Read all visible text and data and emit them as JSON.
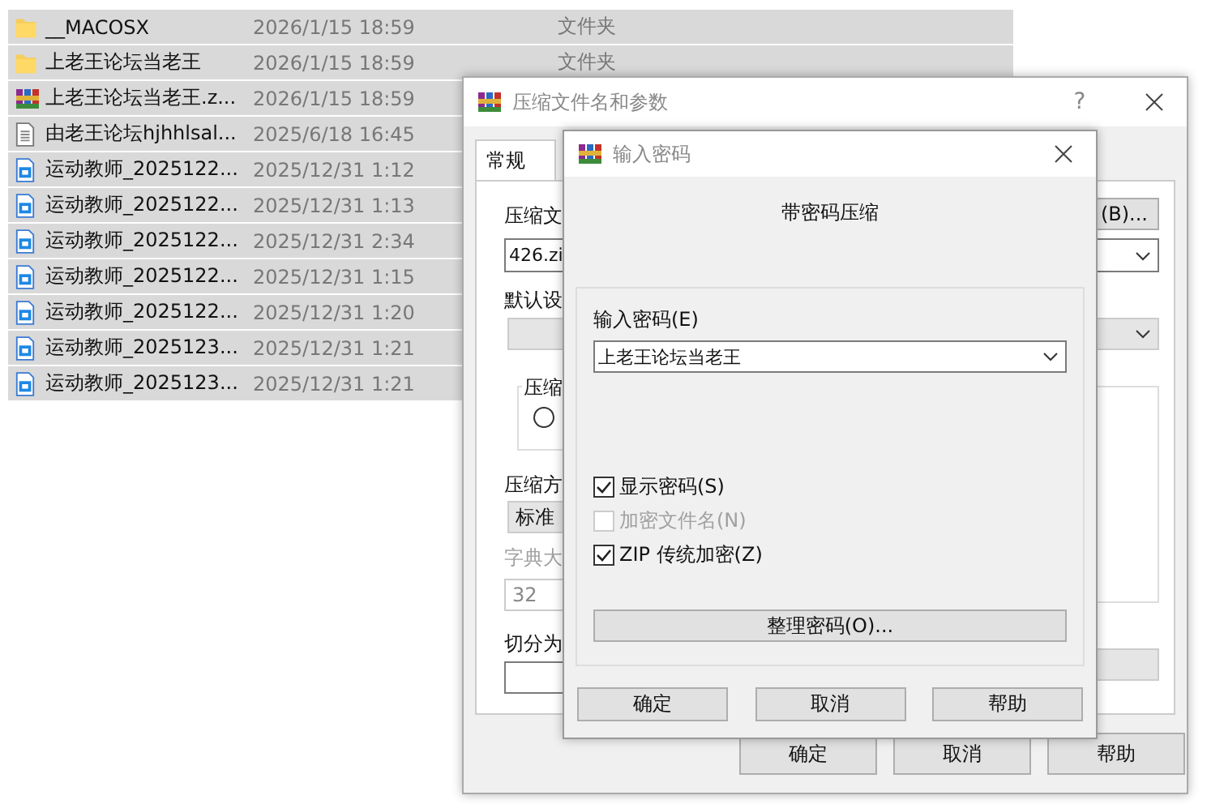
{
  "file_list": {
    "rows": [
      {
        "kind": "folder",
        "name": "__MACOSX",
        "date": "2026/1/15 18:59",
        "type": "文件夹",
        "selected": true
      },
      {
        "kind": "folder",
        "name": "上老王论坛当老王",
        "date": "2026/1/15 18:59",
        "type": "文件夹",
        "selected": true
      },
      {
        "kind": "archive",
        "name": "上老王论坛当老王.z...",
        "date": "2026/1/15 18:59",
        "selected": true
      },
      {
        "kind": "text",
        "name": "由老王论坛hjhhlsal...",
        "date": "2025/6/18 16:45",
        "selected": true
      },
      {
        "kind": "image",
        "name": "运动教师_2025122...",
        "date": "2025/12/31 1:12",
        "selected": true
      },
      {
        "kind": "image",
        "name": "运动教师_2025122...",
        "date": "2025/12/31 1:13",
        "selected": true
      },
      {
        "kind": "image",
        "name": "运动教师_2025122...",
        "date": "2025/12/31 2:34",
        "selected": true
      },
      {
        "kind": "image",
        "name": "运动教师_2025122...",
        "date": "2025/12/31 1:15",
        "selected": true
      },
      {
        "kind": "image",
        "name": "运动教师_2025122...",
        "date": "2025/12/31 1:20",
        "selected": true
      },
      {
        "kind": "image",
        "name": "运动教师_2025123...",
        "date": "2025/12/31 1:21",
        "selected": true
      },
      {
        "kind": "image",
        "name": "运动教师_2025123...",
        "date": "2025/12/31 1:21",
        "selected": true
      }
    ]
  },
  "archive_dialog": {
    "title": "压缩文件名和参数",
    "help_glyph": "?",
    "tabs": [
      {
        "label": "常规",
        "selected": true
      }
    ],
    "archive_name_label": "压缩文",
    "browse_button": "(B)...",
    "archive_name_value": "426.zi",
    "profile_label": "默认设",
    "format_group_label": "压缩",
    "format_radio": {
      "selected": false
    },
    "method_label": "压缩方",
    "method_value": "标准",
    "dictionary_label": "字典大",
    "dictionary_value": "32",
    "split_label": "切分为",
    "buttons": [
      "确定",
      "取消",
      "帮助"
    ]
  },
  "password_dialog": {
    "title": "输入密码",
    "heading": "带密码压缩",
    "password_label": "输入密码(E)",
    "password_value": "上老王论坛当老王",
    "options": [
      {
        "label": "显示密码(S)",
        "checked": true,
        "disabled": false
      },
      {
        "label": "加密文件名(N)",
        "checked": false,
        "disabled": true
      },
      {
        "label": "ZIP 传统加密(Z)",
        "checked": true,
        "disabled": false
      }
    ],
    "organize_button": "整理密码(O)...",
    "buttons": [
      "确定",
      "取消",
      "帮助"
    ]
  }
}
